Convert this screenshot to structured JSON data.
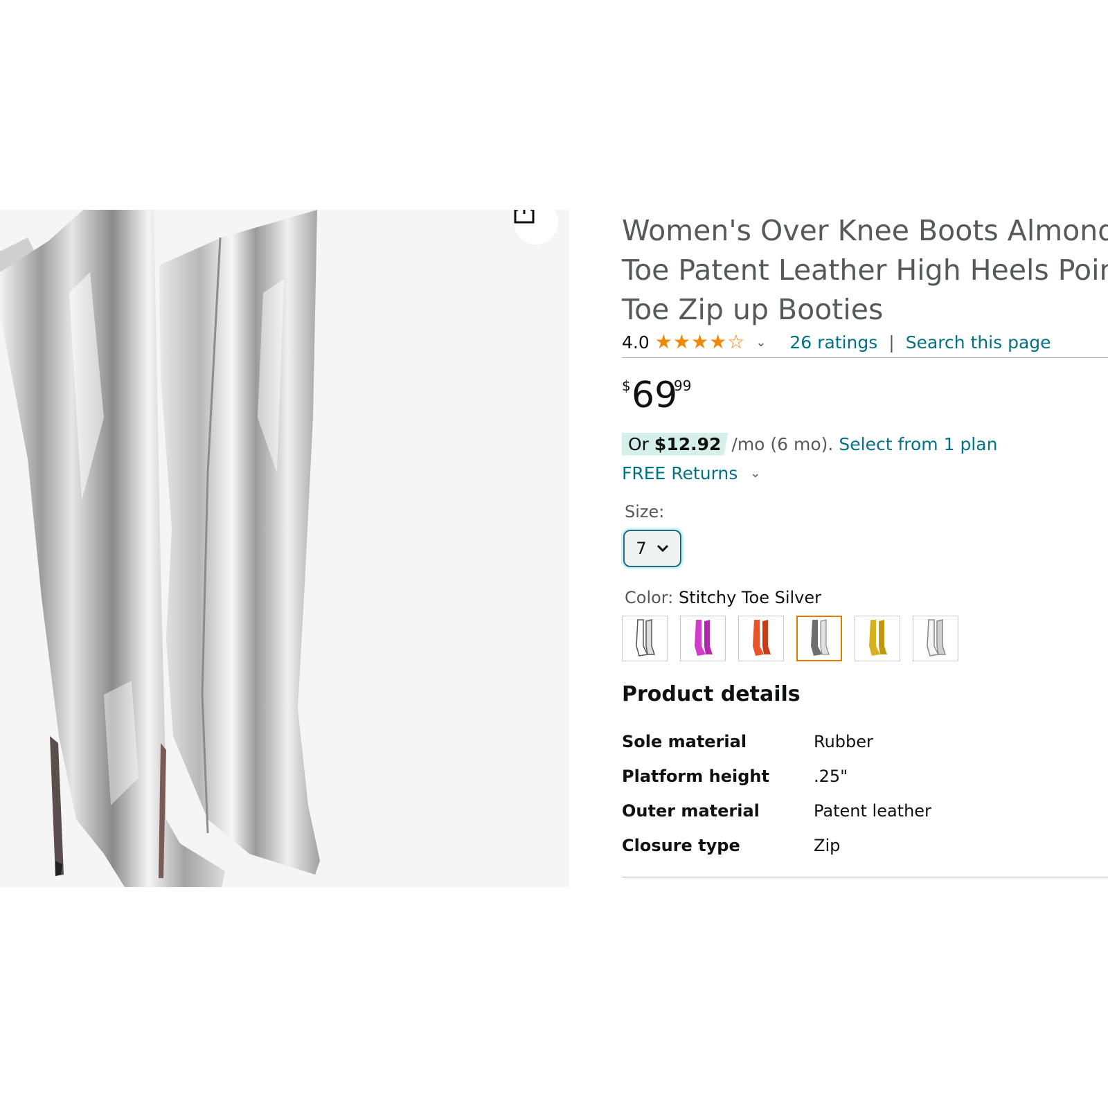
{
  "product": {
    "title_lines": [
      "Women's Over Knee Boots Almond",
      "Toe Patent Leather High Heels Point",
      "Toe Zip up Booties"
    ],
    "rating_value": "4.0",
    "stars_filled": 4,
    "stars_total": 5,
    "ratings_link": "26 ratings",
    "search_link": "Search this page",
    "separator": "|"
  },
  "price": {
    "currency": "$",
    "whole": "69",
    "fraction": "99"
  },
  "installment": {
    "prefix": "Or",
    "amount": "$12.92",
    "terms": "/mo (6 mo).",
    "plan_link": "Select from 1 plan"
  },
  "returns": {
    "label": "FREE Returns"
  },
  "size": {
    "label": "Size:",
    "selected": "7"
  },
  "color": {
    "label": "Color:",
    "selected": "Stitchy Toe Silver",
    "swatches": [
      {
        "name": "outline-silver",
        "color": "#9a9a9a"
      },
      {
        "name": "pink",
        "color": "#d23cc8"
      },
      {
        "name": "orange",
        "color": "#e8552a"
      },
      {
        "name": "stitchy-silver",
        "color": "#7a7a7a"
      },
      {
        "name": "gold",
        "color": "#d8b21e"
      },
      {
        "name": "silver-outline",
        "color": "#b0b0b0"
      }
    ],
    "selected_index": 3
  },
  "details": {
    "heading": "Product details",
    "rows": [
      {
        "key": "Sole material",
        "value": "Rubber"
      },
      {
        "key": "Platform height",
        "value": ".25\""
      },
      {
        "key": "Outer material",
        "value": "Patent leather"
      },
      {
        "key": "Closure type",
        "value": "Zip"
      }
    ]
  },
  "colors": {
    "link": "#007185",
    "star": "#f08804",
    "pill_bg": "#d5f0e8",
    "selected_swatch": "#e77600",
    "focus_ring": "#c8f3fa"
  },
  "icons": {
    "share": "share-icon",
    "caret": "chevron-down-icon",
    "star": "star-icon"
  }
}
